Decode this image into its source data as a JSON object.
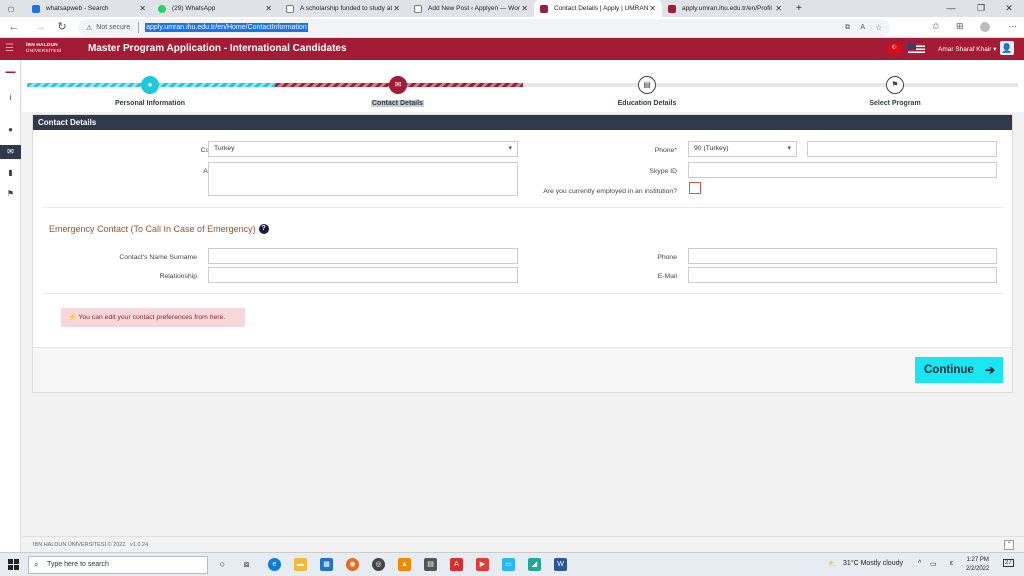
{
  "browser": {
    "tabs": [
      {
        "label": "whatsapweb - Search",
        "favcolor": "#1a73e8"
      },
      {
        "label": "(29) WhatsApp",
        "favcolor": "#25d366"
      },
      {
        "label": "A scholarship funded to study at",
        "favcolor": "#888888"
      },
      {
        "label": "Add New Post ‹ Applyen — Wor",
        "favcolor": "#888888"
      },
      {
        "label": "Contact Details | Apply | UMRAN",
        "favcolor": "#a31b34",
        "active": true
      },
      {
        "label": "apply.umran.ihu.edu.tr/en/Profil",
        "favcolor": "#a31b34"
      }
    ],
    "new_tab": "+",
    "address": {
      "not_secure": "Not secure",
      "url": "apply.umran.ihu.edu.tr/en/Home/ContactInformation"
    }
  },
  "app": {
    "logo_line1": "İBN HALDUN",
    "logo_line2": "ÜNİVERSİTESİ",
    "title": "Master Program Application - International Candidates",
    "user": "Amar Sharaf Khair ▾"
  },
  "steps": [
    {
      "label": "Personal Information",
      "state": "done",
      "icon": "user-icon"
    },
    {
      "label": "Contact Details",
      "state": "current",
      "icon": "envelope-icon"
    },
    {
      "label": "Education Details",
      "state": "todo",
      "icon": "book-icon"
    },
    {
      "label": "Select Program",
      "state": "todo",
      "icon": "flag-icon"
    }
  ],
  "panel": {
    "heading": "Contact Details",
    "country_label": "Country*",
    "country_value": "Turkey",
    "address_label": "Adress*",
    "address_value": "",
    "phone_label": "Phone*",
    "phone_code": "90 (Turkey)",
    "phone_value": "",
    "skype_label": "Skype ID",
    "skype_value": "",
    "employed_label": "Are you currently employed in an institution?",
    "emergency_heading": "Emergency Contact (To Call In Case of Emergency)",
    "emergency_help": "?",
    "contact_name_label": "Contact's Name Surname",
    "relationship_label": "Relationship",
    "em_phone_label": "Phone",
    "em_email_label": "E-Mail",
    "alert_text": "You can edit your contact preferences from here.",
    "continue_label": "Continue"
  },
  "footer": {
    "copyright": "İBN HALDUN ÜNİVERSİTESİ © 2022",
    "version": "v1.0.24"
  },
  "taskbar": {
    "search_placeholder": "Type here to search",
    "weather": "31°C  Mostly cloudy",
    "time": "1:27 PM",
    "date": "2/2/2022",
    "notif_count": "27"
  },
  "colors": {
    "brand": "#a31b34",
    "navy": "#2f3b4c",
    "cyan": "#1fc8db",
    "button": "#19e6f0"
  }
}
